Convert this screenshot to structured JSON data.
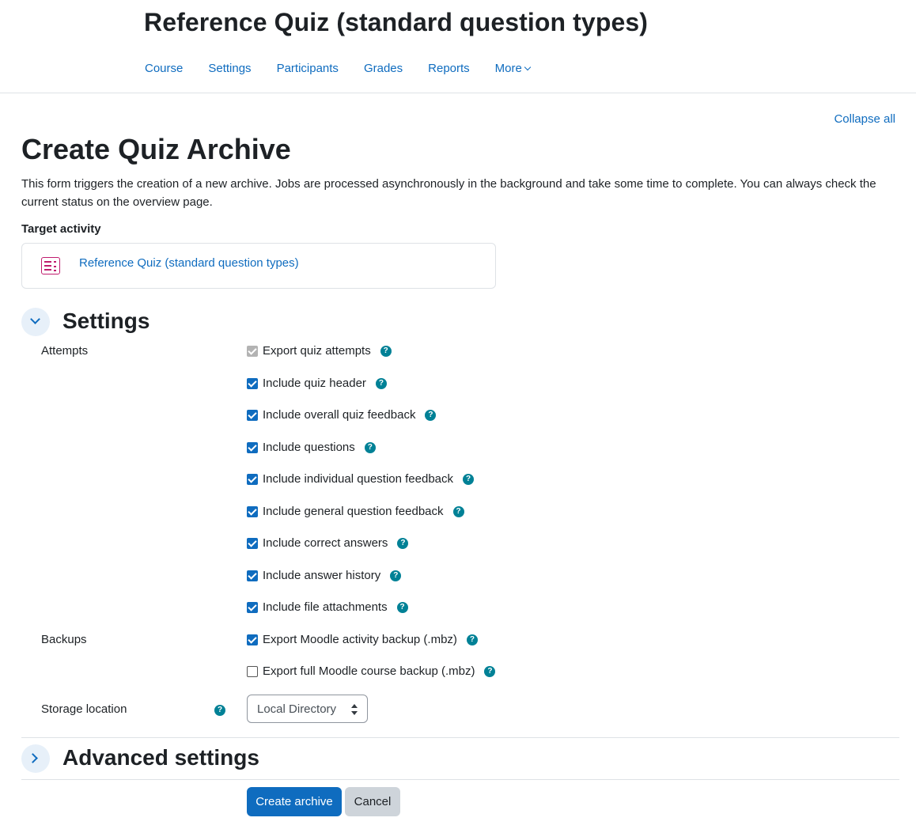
{
  "header": {
    "course_title": "Reference Quiz (standard question types)",
    "nav": [
      "Course",
      "Settings",
      "Participants",
      "Grades",
      "Reports",
      "More"
    ]
  },
  "collapse_all": "Collapse all",
  "page_title": "Create Quiz Archive",
  "intro": "This form triggers the creation of a new archive. Jobs are processed asynchronously in the background and take some time to complete. You can always check the current status on the overview page.",
  "target": {
    "label": "Target activity",
    "activity_name": "Reference Quiz (standard question types)",
    "icon": "quiz-icon"
  },
  "settings": {
    "title": "Settings",
    "attempts_label": "Attempts",
    "attempts": [
      {
        "label": "Export quiz attempts",
        "state": "checked-disabled"
      },
      {
        "label": "Include quiz header",
        "state": "checked"
      },
      {
        "label": "Include overall quiz feedback",
        "state": "checked"
      },
      {
        "label": "Include questions",
        "state": "checked"
      },
      {
        "label": "Include individual question feedback",
        "state": "checked"
      },
      {
        "label": "Include general question feedback",
        "state": "checked"
      },
      {
        "label": "Include correct answers",
        "state": "checked"
      },
      {
        "label": "Include answer history",
        "state": "checked"
      },
      {
        "label": "Include file attachments",
        "state": "checked"
      }
    ],
    "backups_label": "Backups",
    "backups": [
      {
        "label": "Export Moodle activity backup (.mbz)",
        "state": "checked"
      },
      {
        "label": "Export full Moodle course backup (.mbz)",
        "state": "unchecked"
      }
    ],
    "storage_label": "Storage location",
    "storage_value": "Local Directory",
    "help_glyph": "?"
  },
  "advanced": {
    "title": "Advanced settings"
  },
  "buttons": {
    "create": "Create archive",
    "cancel": "Cancel"
  },
  "colors": {
    "accent": "#0f6cbf",
    "help": "#008196",
    "quiz_icon": "#c01c6e"
  }
}
